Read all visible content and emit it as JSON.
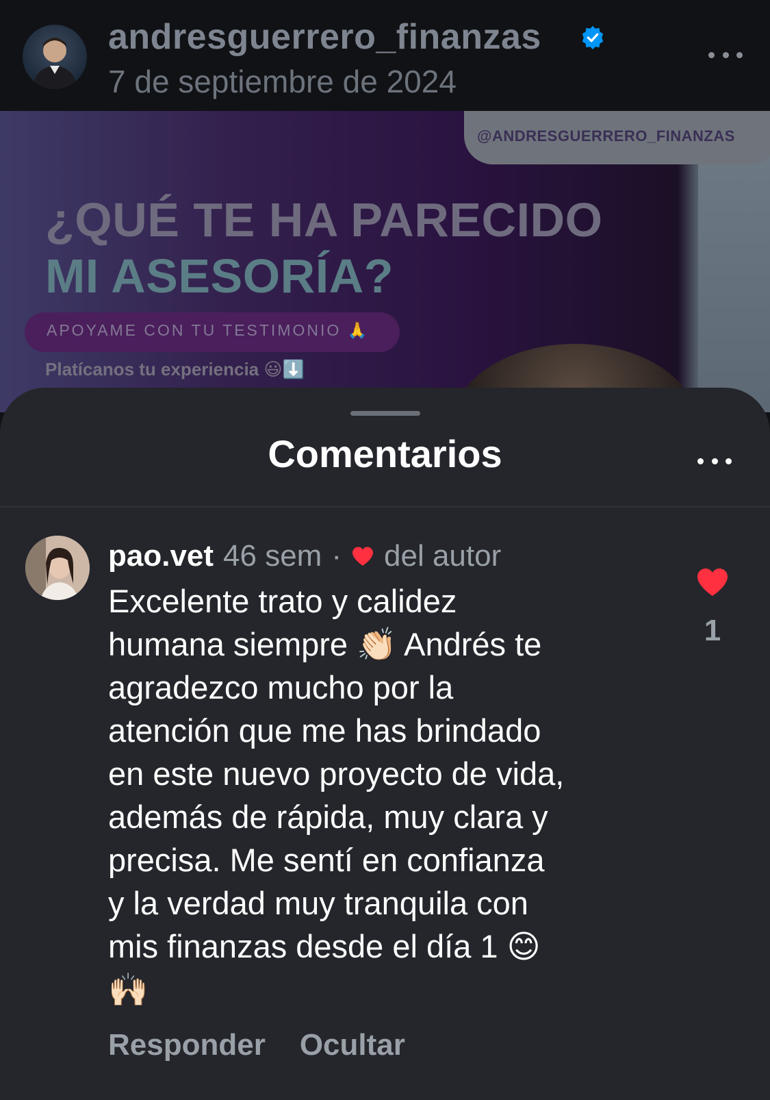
{
  "header": {
    "username": "andresguerrero_finanzas",
    "date": "7 de septiembre de 2024",
    "more_icon": "more-horizontal-icon",
    "verified_icon": "verified-badge-icon"
  },
  "post": {
    "handle": "@ANDRESGUERRERO_FINANZAS",
    "headline_line1": "¿QUÉ TE HA PARECIDO",
    "headline_line2": "MI ASESORÍA?",
    "cta": "APOYAME CON TU TESTIMONIO 🙏",
    "subtext": "Platícanos tu experiencia 😃⬇️"
  },
  "comments_sheet": {
    "title": "Comentarios",
    "more_icon": "more-horizontal-icon"
  },
  "comment": {
    "username": "pao.vet",
    "time": "46 sem",
    "separator": "·",
    "liked_by_author": "del autor",
    "text": "Excelente trato y calidez\nhumana siempre 👏🏻 Andrés te\nagradezco mucho por la\natención que me has brindado\nen este nuevo proyecto de vida,\nademás de rápida, muy clara y\nprecisa. Me sentí en confianza\ny la verdad muy tranquila con\nmis finanzas desde el día 1 😊\n🙌🏻",
    "like_count": "1",
    "reply_label": "Responder",
    "hide_label": "Ocultar"
  },
  "colors": {
    "accent_red": "#ff3040",
    "verified_blue": "#0095f6",
    "sheet_bg": "#24262b",
    "secondary_text": "#9aa0a8"
  }
}
